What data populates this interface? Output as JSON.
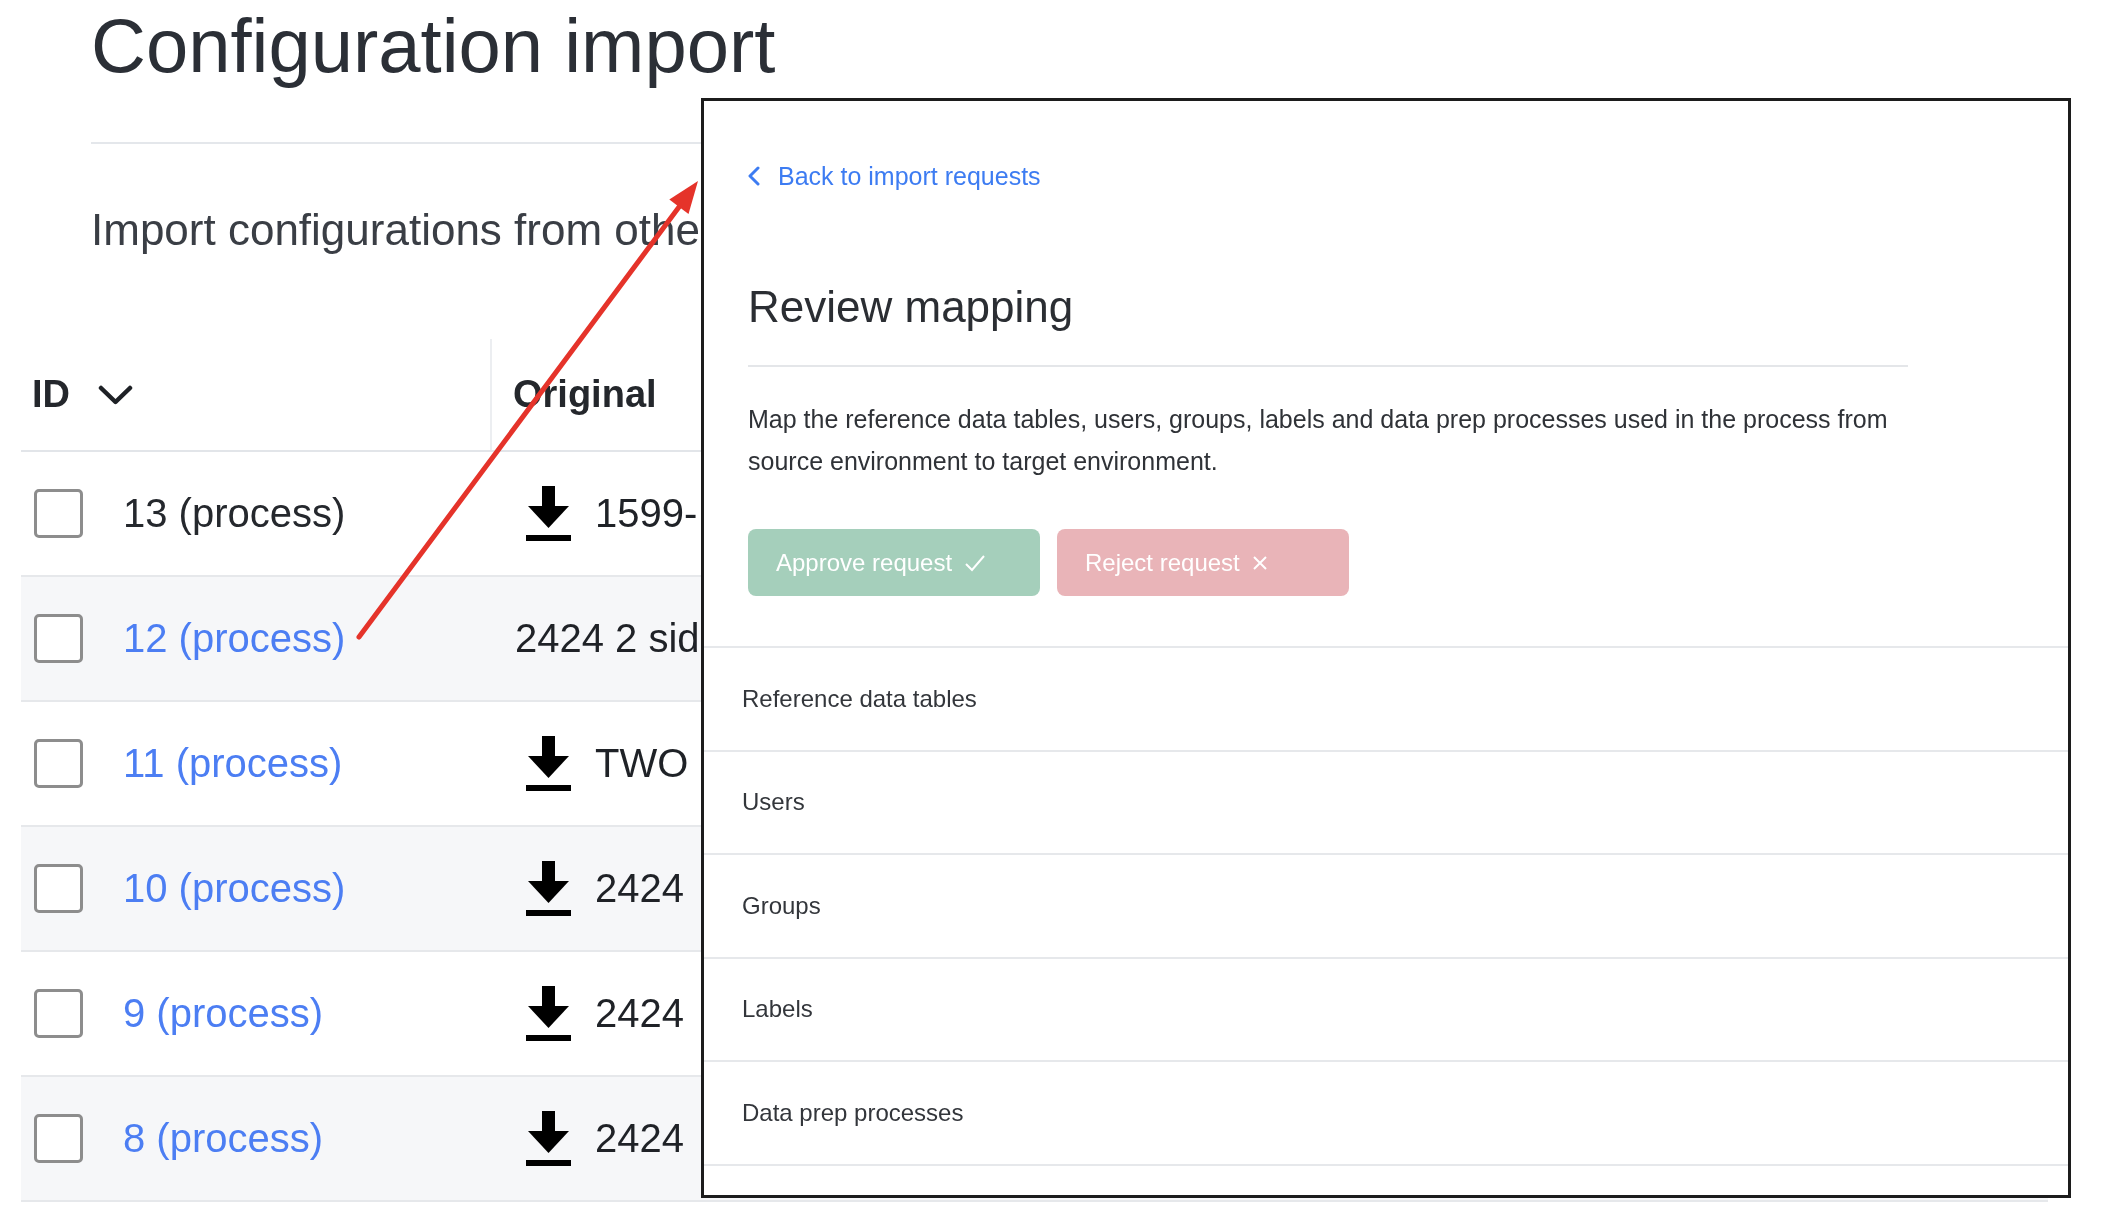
{
  "page": {
    "title": "Configuration import",
    "subtitle": "Import configurations from othe"
  },
  "table": {
    "columns": [
      {
        "label": "ID",
        "sorted": true
      },
      {
        "label": "Original",
        "sorted": false
      }
    ],
    "rows": [
      {
        "id": "13 (process)",
        "kind": "plain",
        "checked": false,
        "download": true,
        "original": "1599-"
      },
      {
        "id": "12 (process)",
        "kind": "link",
        "checked": false,
        "download": false,
        "original": "2424 2 sid"
      },
      {
        "id": "11 (process)",
        "kind": "link",
        "checked": false,
        "download": true,
        "original": "TWO"
      },
      {
        "id": "10 (process)",
        "kind": "link",
        "checked": false,
        "download": true,
        "original": "2424"
      },
      {
        "id": "9 (process)",
        "kind": "link",
        "checked": false,
        "download": true,
        "original": "2424"
      },
      {
        "id": "8 (process)",
        "kind": "link",
        "checked": false,
        "download": true,
        "original": "2424"
      }
    ]
  },
  "panel": {
    "back_link": "Back to import requests",
    "title": "Review mapping",
    "description": "Map the reference data tables, users, groups, labels and data prep processes used in the process from source environment to target environment.",
    "buttons": [
      {
        "label": "Approve request",
        "kind": "approve",
        "disabled": true
      },
      {
        "label": "Reject request",
        "kind": "reject",
        "disabled": true
      }
    ],
    "sections": [
      "Reference data tables",
      "Users",
      "Groups",
      "Labels",
      "Data prep processes"
    ]
  }
}
